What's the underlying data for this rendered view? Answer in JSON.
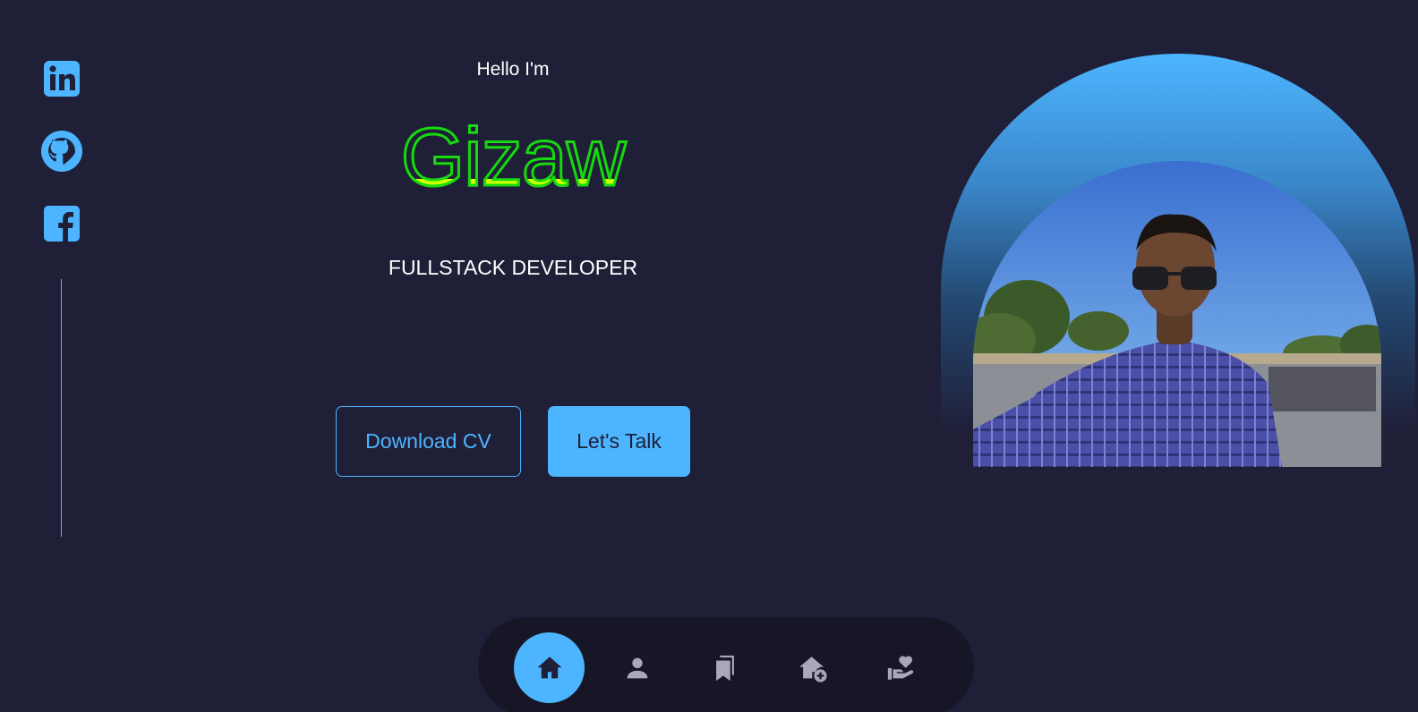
{
  "hero": {
    "greeting": "Hello I'm",
    "name": "Gizaw",
    "role": "FULLSTACK DEVELOPER"
  },
  "buttons": {
    "download_cv": "Download CV",
    "lets_talk": "Let's Talk"
  },
  "socials": [
    {
      "name": "linkedin",
      "icon": "linkedin-icon"
    },
    {
      "name": "github",
      "icon": "github-icon"
    },
    {
      "name": "facebook",
      "icon": "facebook-icon"
    }
  ],
  "nav": {
    "items": [
      {
        "name": "home",
        "icon": "home-icon",
        "active": true
      },
      {
        "name": "about",
        "icon": "person-icon",
        "active": false
      },
      {
        "name": "experience",
        "icon": "bookmarks-icon",
        "active": false
      },
      {
        "name": "services",
        "icon": "house-add-icon",
        "active": false
      },
      {
        "name": "testimonials",
        "icon": "hand-heart-icon",
        "active": false
      }
    ]
  },
  "colors": {
    "background": "#1f1f38",
    "accent": "#4db5ff",
    "name_stroke": "#16d90f",
    "name_fill": "#ccff00",
    "nav_background": "#171626",
    "nav_icon": "#a8a8b8"
  }
}
